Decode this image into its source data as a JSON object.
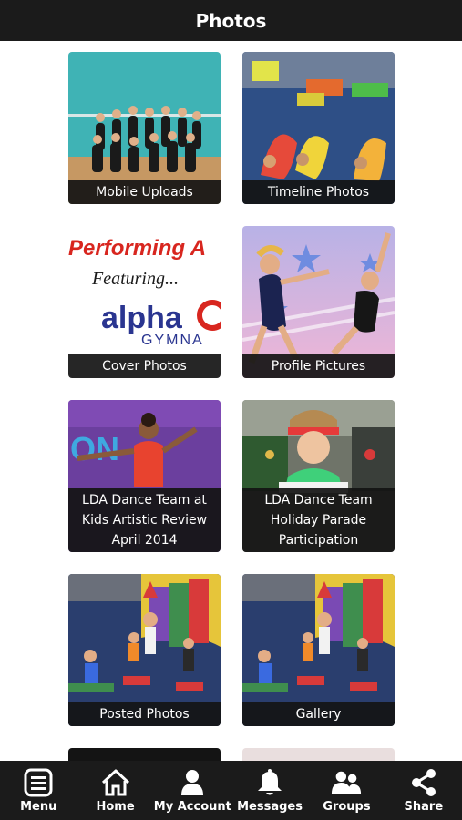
{
  "header": {
    "title": "Photos"
  },
  "albums": [
    {
      "caption": "Mobile Uploads"
    },
    {
      "caption": "Timeline Photos"
    },
    {
      "caption": "Cover Photos",
      "thumb_text": [
        "Performing A",
        "Featuring...",
        "alpha",
        "GYMNA"
      ]
    },
    {
      "caption": "Profile Pictures"
    },
    {
      "caption": "LDA Dance Team at Kids Artistic Review April 2014",
      "thumb_text": "ON"
    },
    {
      "caption": "LDA Dance Team Holiday Parade Participation"
    },
    {
      "caption": "Posted Photos"
    },
    {
      "caption": "Gallery"
    }
  ],
  "tabbar": {
    "items": [
      {
        "label": "Menu",
        "icon": "menu-icon"
      },
      {
        "label": "Home",
        "icon": "home-icon"
      },
      {
        "label": "My Account",
        "icon": "user-icon"
      },
      {
        "label": "Messages",
        "icon": "bell-icon"
      },
      {
        "label": "Groups",
        "icon": "group-icon"
      },
      {
        "label": "Share",
        "icon": "share-icon"
      }
    ]
  },
  "colors": {
    "bar": "#1b1b1b",
    "background": "#ffffff",
    "caption_bg": "#141414"
  }
}
